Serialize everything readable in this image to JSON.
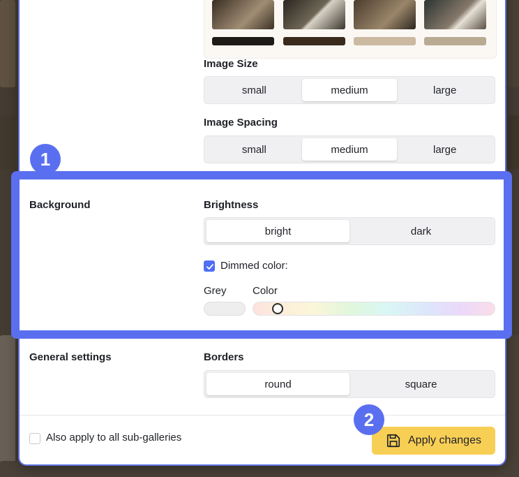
{
  "image_size": {
    "label": "Image Size",
    "options": [
      "small",
      "medium",
      "large"
    ],
    "selected": "medium"
  },
  "image_spacing": {
    "label": "Image Spacing",
    "options": [
      "small",
      "medium",
      "large"
    ],
    "selected": "medium"
  },
  "background": {
    "section_title": "Background",
    "brightness": {
      "label": "Brightness",
      "options": [
        "bright",
        "dark"
      ],
      "selected": "bright"
    },
    "dimmed_color": {
      "label": "Dimmed color:",
      "checked": true
    },
    "grey_label": "Grey",
    "color_label": "Color",
    "color_slider_level": 0.1
  },
  "general_settings": {
    "section_title": "General settings",
    "borders": {
      "label": "Borders",
      "options": [
        "round",
        "square"
      ],
      "selected": "round"
    }
  },
  "footer": {
    "apply_sub_galleries": {
      "label": "Also apply to all sub-galleries",
      "checked": false
    },
    "apply_button": "Apply changes"
  },
  "annotations": {
    "badge_1": "1",
    "badge_2": "2"
  },
  "colors": {
    "accent": "#5a6ff0",
    "apply_button": "#f8cf55",
    "checkbox": "#4f6ef5"
  },
  "icons": {
    "apply_icon": "floppy-disk-icon",
    "check_icon": "checkmark-icon"
  }
}
